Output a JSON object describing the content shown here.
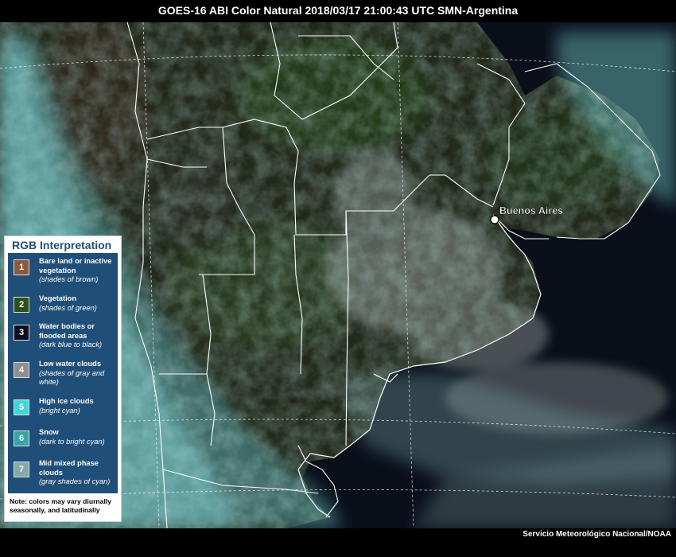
{
  "title": "GOES-16 ABI Color Natural 2018/03/17 21:00:43 UTC SMN-Argentina",
  "credit": "Servicio Meteorológico Nacional/NOAA",
  "map": {
    "city_label": "Buenos Aires",
    "colors": {
      "ocean": "#0a0f1a",
      "land": "#2b3322",
      "land_green": "#2f4a24",
      "andes": "#3a3528",
      "cloud_cyan": "#6fb8ba",
      "cloud_gray": "#8a9290",
      "border": "#ffffff"
    }
  },
  "legend": {
    "title": "RGB Interpretation",
    "items": [
      {
        "num": "1",
        "label": "Bare land or inactive vegetation",
        "desc": "(shades of brown)",
        "color": "#8a5a3c"
      },
      {
        "num": "2",
        "label": "Vegetation",
        "desc": "(shades of green)",
        "color": "#2f4f1f"
      },
      {
        "num": "3",
        "label": "Water bodies or flooded areas",
        "desc": "(dark blue to black)",
        "color": "#0b0f1f"
      },
      {
        "num": "4",
        "label": "Low water clouds",
        "desc": "(shades of gray and white)",
        "color": "#8f8f8f"
      },
      {
        "num": "5",
        "label": "High ice  clouds",
        "desc": "(bright cyan)",
        "color": "#3fd8d8"
      },
      {
        "num": "6",
        "label": "Snow",
        "desc": "(dark to bright cyan)",
        "color": "#36a6a6"
      },
      {
        "num": "7",
        "label": "Mid mixed phase clouds",
        "desc": "(gray shades of cyan)",
        "color": "#86a8a8"
      }
    ],
    "note": "Note: colors may vary diurnally seasonally, and latitudinally"
  }
}
